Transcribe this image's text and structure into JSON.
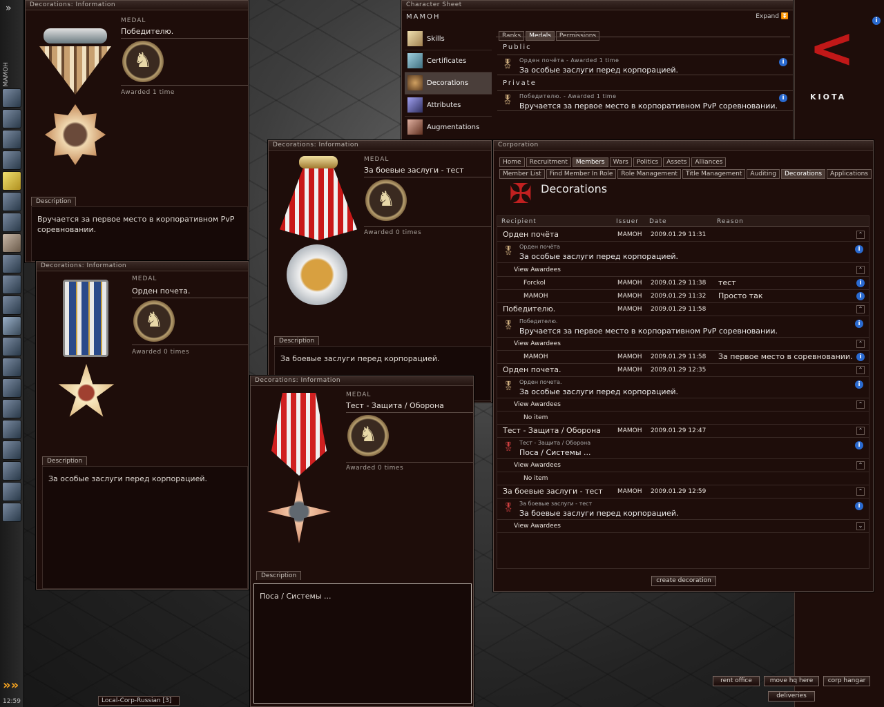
{
  "sidebar": {
    "clock": "12:59",
    "pilot": "МАМОН",
    "chat_label": "Local-Corp-Russian [3]"
  },
  "w1": {
    "title": "Decorations: Information",
    "kind": "MEDAL",
    "name": "Победителю.",
    "awarded": "Awarded 1 time",
    "desc_tab": "Description",
    "desc": "Вручается за первое место в корпоративном PvP соревновании."
  },
  "w2": {
    "title": "Decorations: Information",
    "kind": "MEDAL",
    "name": "Орден почета.",
    "awarded": "Awarded 0 times",
    "desc_tab": "Description",
    "desc": "За особые заслуги перед корпорацией."
  },
  "w3": {
    "title": "Decorations: Information",
    "kind": "MEDAL",
    "name": "За боевые заслуги - тест",
    "awarded": "Awarded 0 times",
    "desc_tab": "Description",
    "desc": "За боевые заслуги перед корпорацией."
  },
  "w4": {
    "title": "Decorations: Information",
    "kind": "MEDAL",
    "name": "Тест - Защита / Оборона",
    "awarded": "Awarded 0 times",
    "desc_tab": "Description",
    "desc": "Поса / Системы ..."
  },
  "cs": {
    "title": "Character Sheet",
    "pilot": "МАМОН",
    "expand": "Expand",
    "menu": [
      "Skills",
      "Certificates",
      "Decorations",
      "Attributes",
      "Augmentations"
    ],
    "tabs": [
      "Ranks",
      "Medals",
      "Permissions"
    ],
    "public_h": "Public",
    "private_h": "Private",
    "pub": {
      "head": "Орден почёта  - Awarded 1 time",
      "text": "За особые заслуги перед корпорацией."
    },
    "priv": {
      "head": "Победителю.  - Awarded 1 time",
      "text": "Вручается за первое место в корпоративном PvP соревновании."
    },
    "corp_logo_text": "KIOTA"
  },
  "corp": {
    "title": "Corporation",
    "tabs1": [
      "Home",
      "Recruitment",
      "Members",
      "Wars",
      "Politics",
      "Assets",
      "Alliances"
    ],
    "tabs2": [
      "Member List",
      "Find Member In Role",
      "Role Management",
      "Title Management",
      "Auditing",
      "Decorations",
      "Applications"
    ],
    "heading": "Decorations",
    "cols": [
      "Recipient",
      "Issuer",
      "Date",
      "Reason"
    ],
    "r1": {
      "name": "Орден почёта",
      "issuer": "МАМОН",
      "date": "2009.01.29 11:31",
      "sub": "Орден почёта",
      "text": "За особые заслуги перед корпорацией."
    },
    "va": "View Awardees",
    "a1": {
      "name": "Forckol",
      "issuer": "МАМОН",
      "date": "2009.01.29 11:38",
      "reason": "тест"
    },
    "a2": {
      "name": "МАМОН",
      "issuer": "МАМОН",
      "date": "2009.01.29 11:32",
      "reason": "Просто так"
    },
    "r2": {
      "name": "Победителю.",
      "issuer": "МАМОН",
      "date": "2009.01.29 11:58",
      "sub": "Победителю.",
      "text": "Вручается за первое место в корпоративном PvP соревновании."
    },
    "a3": {
      "name": "МАМОН",
      "issuer": "МАМОН",
      "date": "2009.01.29 11:58",
      "reason": "За первое место в соревновании."
    },
    "r3": {
      "name": "Орден почета.",
      "issuer": "МАМОН",
      "date": "2009.01.29 12:35",
      "sub": "Орден почета.",
      "text": "За особые заслуги перед корпорацией."
    },
    "noitem": "No item",
    "r4": {
      "name": "Тест - Защита / Оборона",
      "issuer": "МАМОН",
      "date": "2009.01.29 12:47",
      "sub": "Тест - Защита / Оборона",
      "text": "Поса / Системы ..."
    },
    "r5": {
      "name": "За боевые заслуги - тест",
      "issuer": "МАМОН",
      "date": "2009.01.29 12:59",
      "sub": "За боевые заслуги - тест",
      "text": "За боевые заслуги перед корпорацией."
    },
    "create": "create decoration"
  },
  "bottom": {
    "b1": "rent office",
    "b2": "move hq here",
    "b3": "corp hangar",
    "b4": "deliveries"
  }
}
